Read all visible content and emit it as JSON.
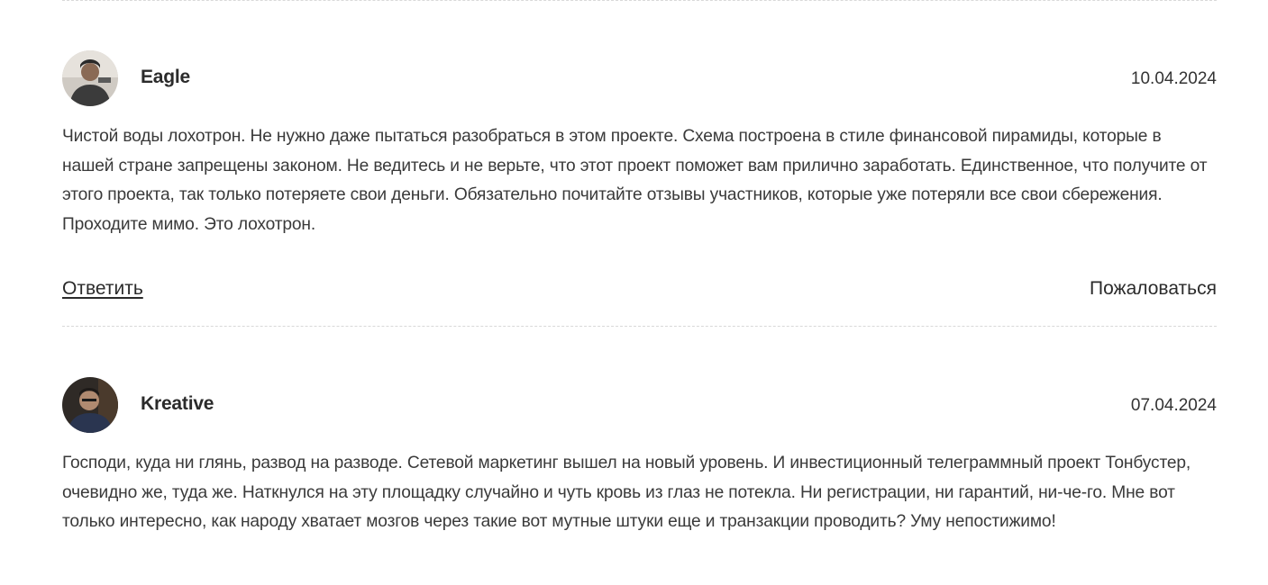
{
  "comments": [
    {
      "author": "Eagle",
      "date": "10.04.2024",
      "text": "Чистой воды лохотрон. Не нужно даже пытаться разобраться в этом проекте. Схема построена в стиле финансовой пирамиды, которые в нашей стране запрещены законом. Не ведитесь и не верьте, что этот проект поможет вам прилично заработать. Единственное, что получите от этого проекта, так только потеряете свои деньги. Обязательно почитайте отзывы участников, которые уже потеряли все свои сбережения. Проходите мимо. Это лохотрон.",
      "reply_label": "Ответить",
      "report_label": "Пожаловаться"
    },
    {
      "author": "Kreative",
      "date": "07.04.2024",
      "text": "Господи, куда ни глянь, развод на разводе. Сетевой маркетинг вышел на новый уровень. И инвестиционный телеграммный проект Тонбустер, очевидно же, туда же. Наткнулся на эту площадку случайно и чуть кровь из глаз не потекла. Ни регистрации, ни гарантий, ни-че-го. Мне вот только интересно, как народу хватает мозгов через такие вот мутные штуки еще и транзакции проводить? Уму непостижимо!"
    }
  ]
}
